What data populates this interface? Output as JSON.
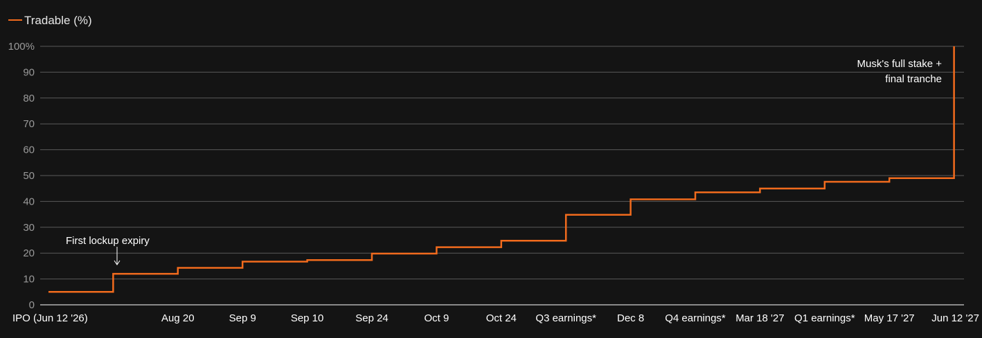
{
  "chart_data": {
    "type": "line",
    "step": true,
    "series": [
      {
        "name": "Tradable (%)",
        "color": "#f26b1d",
        "values": [
          5,
          12,
          14.3,
          16.7,
          17.3,
          19.8,
          22.3,
          24.8,
          34.8,
          40.8,
          43.5,
          45,
          47.6,
          49,
          100
        ]
      }
    ],
    "categories": [
      "IPO (Jun 12 '26)",
      "",
      "Aug 20",
      "Sep 9",
      "Sep 10",
      "Sep 24",
      "Oct 9",
      "Oct 24",
      "Q3 earnings*",
      "Dec 8",
      "Q4 earnings*",
      "Mar 18 '27",
      "Q1 earnings*",
      "May 17 '27",
      "Jun 12 '27"
    ],
    "ylim": [
      0,
      100
    ],
    "yticks": [
      0,
      10,
      20,
      30,
      40,
      50,
      60,
      70,
      80,
      90,
      100
    ],
    "ytick_labels": [
      "0",
      "10",
      "20",
      "30",
      "40",
      "50",
      "60",
      "70",
      "80",
      "90",
      "100%"
    ],
    "grid": true,
    "legend": "top-left",
    "annotations": [
      {
        "text": "First lockup expiry",
        "x_index": 1,
        "arrow": true
      },
      {
        "text_lines": [
          "Musk's full stake +",
          "final tranche"
        ],
        "x_index": 14
      }
    ]
  },
  "colors": {
    "background": "#141414",
    "grid": "#5a5a5a",
    "axis": "#ffffff",
    "line": "#f26b1d"
  }
}
